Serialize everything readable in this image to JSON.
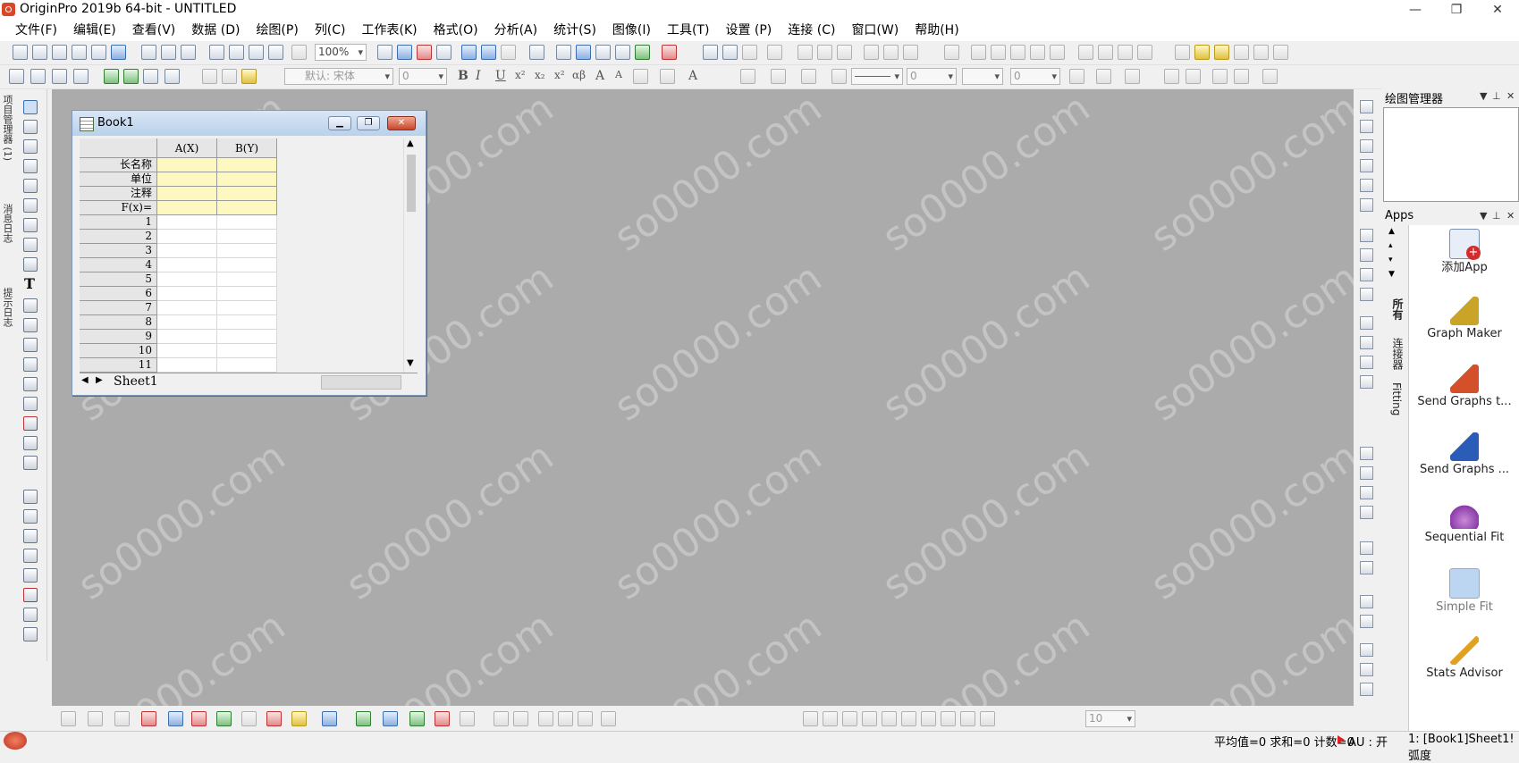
{
  "window": {
    "title": "OriginPro 2019b 64-bit - UNTITLED",
    "controls": [
      "—",
      "❐",
      "✕"
    ]
  },
  "menu": [
    "文件(F)",
    "编辑(E)",
    "查看(V)",
    "数据 (D)",
    "绘图(P)",
    "列(C)",
    "工作表(K)",
    "格式(O)",
    "分析(A)",
    "统计(S)",
    "图像(I)",
    "工具(T)",
    "设置 (P)",
    "连接 (C)",
    "窗口(W)",
    "帮助(H)"
  ],
  "toolbar": {
    "zoom": "100%",
    "font": "默认: 宋体",
    "font_size": "0",
    "line_width": "0",
    "fill_value": "0",
    "style_size": "10"
  },
  "left_tabs": [
    "项目管理器 (1)",
    "消息日志",
    "提示日志"
  ],
  "book": {
    "title": "Book1",
    "columns": [
      "A(X)",
      "B(Y)"
    ],
    "meta_rows": [
      "长名称",
      "单位",
      "注释",
      "F(x)="
    ],
    "rows": [
      "1",
      "2",
      "3",
      "4",
      "5",
      "6",
      "7",
      "8",
      "9",
      "10",
      "11"
    ],
    "sheet": "Sheet1"
  },
  "plot_manager": {
    "title": "绘图管理器"
  },
  "apps": {
    "title": "Apps",
    "tabs": [
      "所有",
      "连接器",
      "Fitting"
    ],
    "items": [
      {
        "name": "添加App",
        "color": "#d62b2b"
      },
      {
        "name": "Graph Maker",
        "color": "#c9a426"
      },
      {
        "name": "Send Graphs t...",
        "color": "#d4502a"
      },
      {
        "name": "Send Graphs ...",
        "color": "#2b5cb8"
      },
      {
        "name": "Sequential Fit",
        "color": "#8a3aa8"
      },
      {
        "name": "Simple Fit",
        "color": "#9ec3ea"
      },
      {
        "name": "Stats Advisor",
        "color": "#e0a020"
      }
    ]
  },
  "watermark": "so0000.com",
  "status": {
    "stats": "平均值=0 求和=0 计数=0",
    "au": "AU : 开",
    "sheet": "1: [Book1]Sheet1! 弧度"
  }
}
